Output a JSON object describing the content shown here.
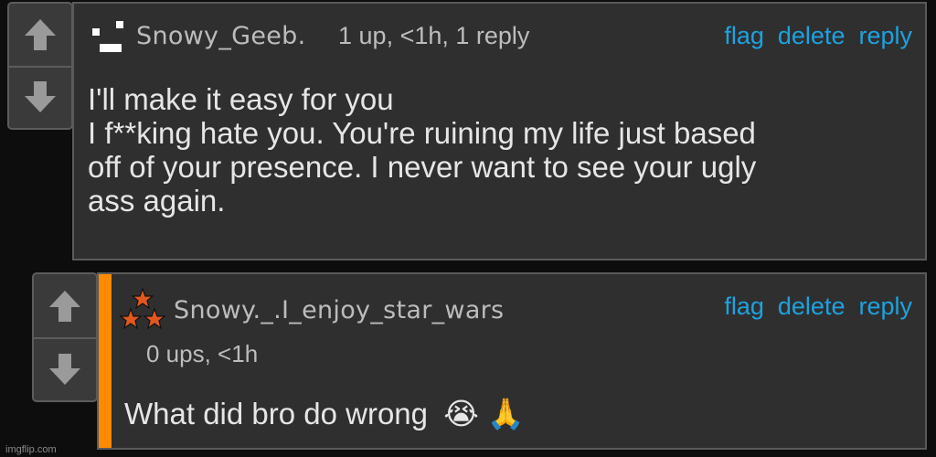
{
  "comment1": {
    "username": "Snowy_Geeb.",
    "meta": "1 up, <1h, 1 reply",
    "actions": {
      "flag": "flag",
      "delete": "delete",
      "reply": "reply"
    },
    "lines": [
      "I'll make it easy for you",
      "I f**king hate you. You're ruining my life just based",
      "off of your presence. I never want to see your ugly",
      "ass again."
    ],
    "avatar_icon": "pixel-blocks-icon"
  },
  "comment2": {
    "username": "Snowy._.I_enjoy_star_wars",
    "meta": "0 ups, <1h",
    "actions": {
      "flag": "flag",
      "delete": "delete",
      "reply": "reply"
    },
    "text": "What did bro do wrong",
    "emojis": [
      "😭",
      "🙏"
    ],
    "avatar_icon": "three-stars-icon"
  },
  "watermark": "imgflip.com",
  "colors": {
    "link": "#1ea2e0",
    "accent_bar": "#ff8a00",
    "card_bg": "#2f2f2f",
    "page_bg": "#0d0d0d"
  }
}
